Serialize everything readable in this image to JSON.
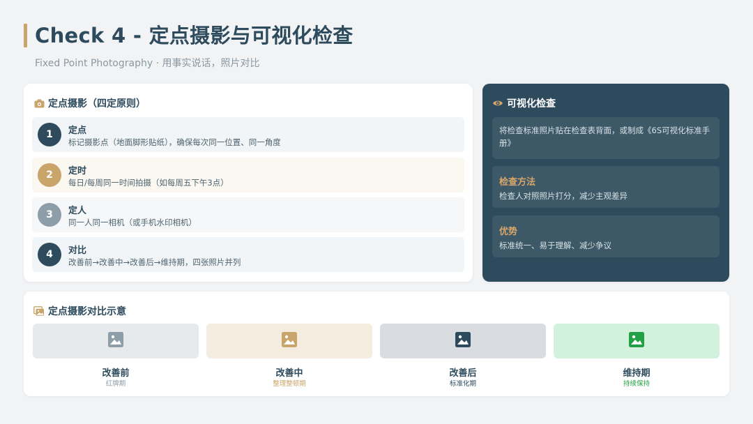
{
  "header": {
    "title": "Check 4 - 定点摄影与可视化检查",
    "subtitle": "Fixed Point Photography · 用事实说话，照片对比"
  },
  "principles": {
    "title": "定点摄影（四定原则）",
    "icon": "camera-icon",
    "items": [
      {
        "number": "1",
        "title": "定点",
        "desc": "标记摄影点（地面脚形贴纸），确保每次同一位置、同一角度",
        "color": "#2d4b5c"
      },
      {
        "number": "2",
        "title": "定时",
        "desc": "每日/每周同一时间拍摄（如每周五下午3点）",
        "color": "#c9a46b"
      },
      {
        "number": "3",
        "title": "定人",
        "desc": "同一人同一相机（或手机水印相机）",
        "color": "#8d9ea9"
      },
      {
        "number": "4",
        "title": "对比",
        "desc": "改善前→改善中→改善后→维持期，四张照片并列",
        "color": "#2d4b5c"
      }
    ]
  },
  "visual_check": {
    "title": "可视化检查",
    "icon": "eye-icon",
    "intro": "将检查标准照片贴在检查表背面，或制成《6S可视化标准手册》",
    "method_title": "检查方法",
    "method_desc": "检查人对照照片打分，减少主观差异",
    "advantage_title": "优势",
    "advantage_desc": "标准统一、易于理解、减少争议"
  },
  "comparison": {
    "title": "定点摄影对比示意",
    "icon": "images-icon",
    "stages": [
      {
        "name": "改善前",
        "sub": "红牌期",
        "bg": "#e7eaed",
        "icon_color": "#8d9ea9",
        "sub_color": "#8d9ea9"
      },
      {
        "name": "改善中",
        "sub": "整理整顿期",
        "bg": "#f4ecdf",
        "icon_color": "#c9a46b",
        "sub_color": "#c9a46b"
      },
      {
        "name": "改善后",
        "sub": "标准化期",
        "bg": "#d9dde1",
        "icon_color": "#2d4b5c",
        "sub_color": "#2d4b5c"
      },
      {
        "name": "维持期",
        "sub": "持续保持",
        "bg": "#d3f2dd",
        "icon_color": "#22a045",
        "sub_color": "#22a045"
      }
    ]
  },
  "colors": {
    "primary": "#2d4b5c",
    "accent": "#c9a46b",
    "background": "#f1f3f5"
  }
}
